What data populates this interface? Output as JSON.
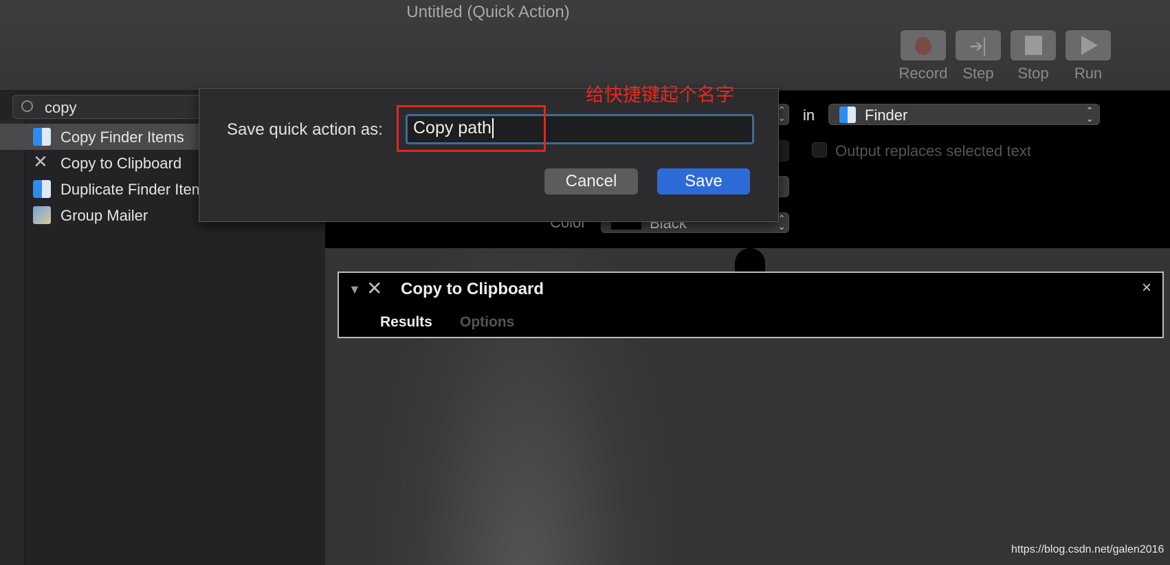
{
  "window": {
    "title": "Untitled (Quick Action)"
  },
  "toolbar": {
    "buttons": [
      {
        "label": "Record",
        "icon": "record-icon",
        "color": "#7a4a46"
      },
      {
        "label": "Step",
        "icon": "step-icon"
      },
      {
        "label": "Stop",
        "icon": "stop-icon"
      },
      {
        "label": "Run",
        "icon": "run-icon"
      }
    ]
  },
  "sidebar": {
    "search": {
      "value": "copy"
    },
    "items": [
      {
        "label": "Copy Finder Items",
        "icon": "finder-icon",
        "selected": true
      },
      {
        "label": "Copy to Clipboard",
        "icon": "tools-icon"
      },
      {
        "label": "Duplicate Finder Items",
        "icon": "finder-icon"
      },
      {
        "label": "Group Mailer",
        "icon": "mail-icon"
      }
    ]
  },
  "workflow": {
    "in_label": "in",
    "application": "Finder",
    "output_replaces_label": "Output replaces selected text",
    "output_replaces_checked": false,
    "color_label": "Color",
    "color_value": "Black"
  },
  "dialog": {
    "label": "Save quick action as:",
    "value": "Copy path",
    "cancel": "Cancel",
    "save": "Save",
    "accent": "#2d6bd9"
  },
  "annotation": {
    "text": "给快捷键起个名字",
    "color": "#e8281d"
  },
  "action": {
    "title": "Copy to Clipboard",
    "tabs": [
      {
        "label": "Results",
        "active": true
      },
      {
        "label": "Options",
        "active": false
      }
    ],
    "close": "×"
  },
  "watermark": "https://blog.csdn.net/galen2016"
}
